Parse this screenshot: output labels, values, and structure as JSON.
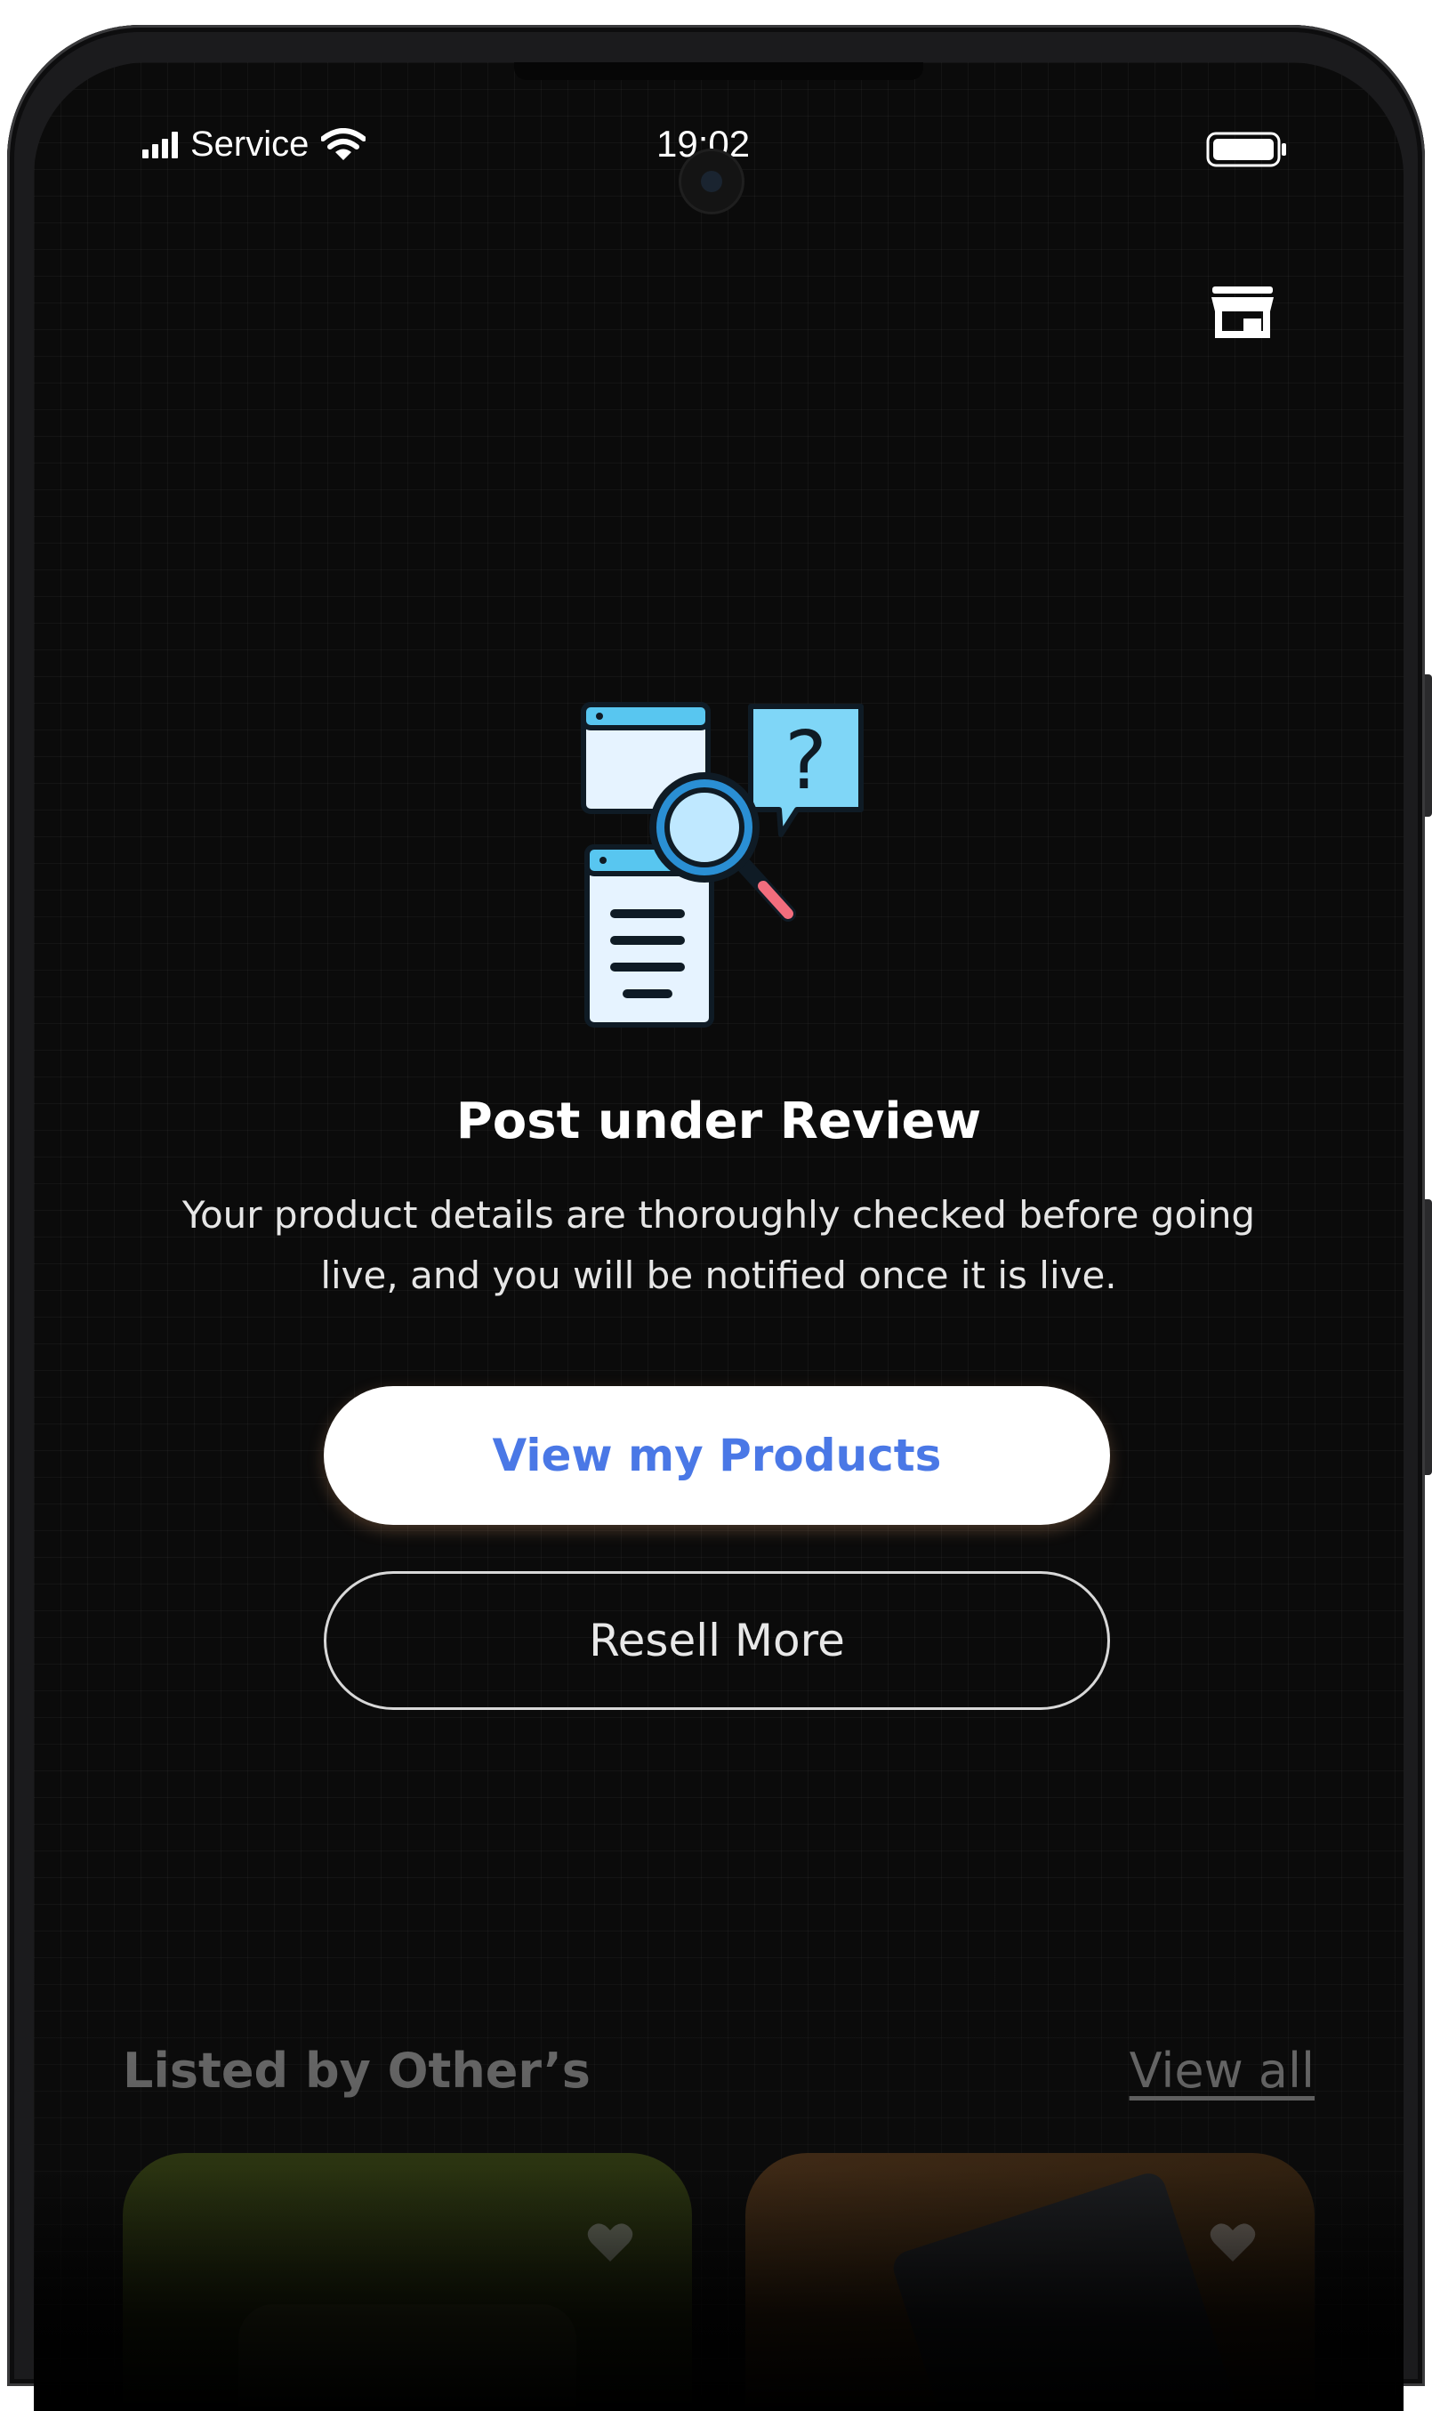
{
  "status_bar": {
    "carrier": "Service",
    "time": "19:02"
  },
  "icons": {
    "store": "store-icon",
    "wifi": "wifi-icon",
    "battery": "battery-icon",
    "signal": "signal-icon",
    "heart": "heart-icon"
  },
  "review": {
    "title": "Post under Review",
    "description_line1": "Your product details are thoroughly checked before going",
    "description_line2": "live, and you will be notified once it is live."
  },
  "actions": {
    "primary_label": "View my Products",
    "secondary_label": "Resell More"
  },
  "listings": {
    "section_title": "Listed by Other’s",
    "view_all_label": "View all"
  },
  "colors": {
    "background": "#0b0b0b",
    "primary_text": "#4a78e6",
    "button_bg": "#ffffff"
  }
}
